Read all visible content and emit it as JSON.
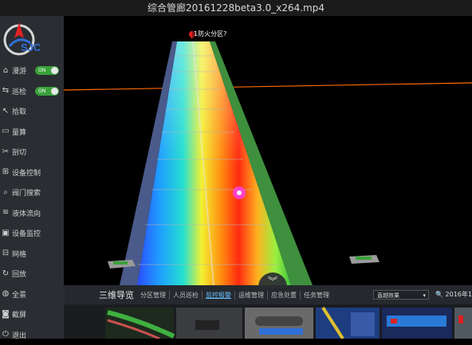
{
  "window": {
    "title": "综合管廊20161228beta3.0_x264.mp4"
  },
  "logo": {
    "text": "SJC"
  },
  "sidebar": {
    "items": [
      {
        "label": "漫游",
        "icon": "home-icon",
        "toggle": "ON"
      },
      {
        "label": "巡检",
        "icon": "route-icon",
        "toggle": "ON"
      },
      {
        "label": "拾取",
        "icon": "cursor-icon"
      },
      {
        "label": "量算",
        "icon": "ruler-icon"
      },
      {
        "label": "剖切",
        "icon": "cut-icon"
      },
      {
        "label": "设备控制",
        "icon": "device-icon"
      },
      {
        "label": "阀门搜索",
        "icon": "valve-icon"
      },
      {
        "label": "液体流向",
        "icon": "flow-icon"
      },
      {
        "label": "设备监控",
        "icon": "monitor-icon"
      },
      {
        "label": "网格",
        "icon": "grid-icon"
      },
      {
        "label": "回放",
        "icon": "replay-icon"
      },
      {
        "label": "全景",
        "icon": "globe-icon"
      },
      {
        "label": "截屏",
        "icon": "camera-icon"
      },
      {
        "label": "退出",
        "icon": "power-icon"
      }
    ]
  },
  "viewport": {
    "marker_label": "1防火分区?"
  },
  "bottom": {
    "title": "三维导览",
    "tabs": [
      "分区管理",
      "人员巡检",
      "监控报警",
      "运维管理",
      "应急处置",
      "任务管理"
    ],
    "active_tab": 2,
    "select_value": "直越效果",
    "date": "2016年1"
  },
  "colors": {
    "accent": "#3aa23a",
    "tab_active": "#6ac0ff",
    "orange_line": "#ff6a00"
  }
}
